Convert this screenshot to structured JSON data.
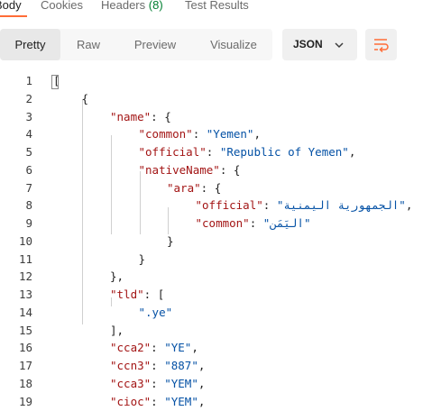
{
  "tabs": {
    "body": "Body",
    "cookies": "Cookies",
    "headers": "Headers",
    "headers_count": "(8)",
    "test_results": "Test Results"
  },
  "view_modes": {
    "pretty": "Pretty",
    "raw": "Raw",
    "preview": "Preview",
    "visualize": "Visualize",
    "selected": "Pretty"
  },
  "format": {
    "selected": "JSON"
  },
  "icons": {
    "format_dropdown": "chevron-down-icon",
    "wrap": "wrap-lines-icon",
    "wrap_color": "#ff6c37"
  },
  "colors": {
    "key": "#a31515",
    "string": "#0451a5",
    "accent": "#ff6c37",
    "count": "#007f31"
  },
  "lines": [
    {
      "n": "1",
      "parts": [
        {
          "t": "[",
          "c": "punc"
        }
      ]
    },
    {
      "n": "2",
      "parts": [
        {
          "t": "{",
          "c": "punc"
        }
      ]
    },
    {
      "n": "3",
      "parts": [
        {
          "t": "\"name\"",
          "c": "key"
        },
        {
          "t": ": {",
          "c": "punc"
        }
      ]
    },
    {
      "n": "4",
      "parts": [
        {
          "t": "\"common\"",
          "c": "key"
        },
        {
          "t": ": ",
          "c": "punc"
        },
        {
          "t": "\"Yemen\"",
          "c": "str"
        },
        {
          "t": ",",
          "c": "punc"
        }
      ]
    },
    {
      "n": "5",
      "parts": [
        {
          "t": "\"official\"",
          "c": "key"
        },
        {
          "t": ": ",
          "c": "punc"
        },
        {
          "t": "\"Republic of Yemen\"",
          "c": "str"
        },
        {
          "t": ",",
          "c": "punc"
        }
      ]
    },
    {
      "n": "6",
      "parts": [
        {
          "t": "\"nativeName\"",
          "c": "key"
        },
        {
          "t": ": {",
          "c": "punc"
        }
      ]
    },
    {
      "n": "7",
      "parts": [
        {
          "t": "\"ara\"",
          "c": "key"
        },
        {
          "t": ": {",
          "c": "punc"
        }
      ]
    },
    {
      "n": "8",
      "parts": [
        {
          "t": "\"official\"",
          "c": "key"
        },
        {
          "t": ": ",
          "c": "punc"
        },
        {
          "t": "\"الجمهورية اليمنية\"",
          "c": "str"
        },
        {
          "t": ",",
          "c": "punc"
        }
      ]
    },
    {
      "n": "9",
      "parts": [
        {
          "t": "\"common\"",
          "c": "key"
        },
        {
          "t": ": ",
          "c": "punc"
        },
        {
          "t": "\"اليَمَن\"",
          "c": "str"
        }
      ]
    },
    {
      "n": "10",
      "parts": [
        {
          "t": "}",
          "c": "punc"
        }
      ]
    },
    {
      "n": "11",
      "parts": [
        {
          "t": "}",
          "c": "punc"
        }
      ]
    },
    {
      "n": "12",
      "parts": [
        {
          "t": "},",
          "c": "punc"
        }
      ]
    },
    {
      "n": "13",
      "parts": [
        {
          "t": "\"tld\"",
          "c": "key"
        },
        {
          "t": ": [",
          "c": "punc"
        }
      ]
    },
    {
      "n": "14",
      "parts": [
        {
          "t": "\".ye\"",
          "c": "str"
        }
      ]
    },
    {
      "n": "15",
      "parts": [
        {
          "t": "],",
          "c": "punc"
        }
      ]
    },
    {
      "n": "16",
      "parts": [
        {
          "t": "\"cca2\"",
          "c": "key"
        },
        {
          "t": ": ",
          "c": "punc"
        },
        {
          "t": "\"YE\"",
          "c": "str"
        },
        {
          "t": ",",
          "c": "punc"
        }
      ]
    },
    {
      "n": "17",
      "parts": [
        {
          "t": "\"ccn3\"",
          "c": "key"
        },
        {
          "t": ": ",
          "c": "punc"
        },
        {
          "t": "\"887\"",
          "c": "str"
        },
        {
          "t": ",",
          "c": "punc"
        }
      ]
    },
    {
      "n": "18",
      "parts": [
        {
          "t": "\"cca3\"",
          "c": "key"
        },
        {
          "t": ": ",
          "c": "punc"
        },
        {
          "t": "\"YEM\"",
          "c": "str"
        },
        {
          "t": ",",
          "c": "punc"
        }
      ]
    },
    {
      "n": "19",
      "parts": [
        {
          "t": "\"cioc\"",
          "c": "key"
        },
        {
          "t": ": ",
          "c": "punc"
        },
        {
          "t": "\"YEM\"",
          "c": "str"
        },
        {
          "t": ",",
          "c": "punc"
        }
      ]
    }
  ]
}
